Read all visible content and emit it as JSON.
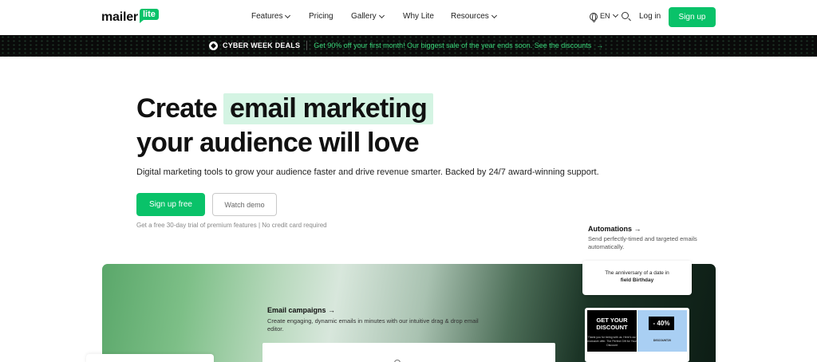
{
  "logo": {
    "text": "mailer",
    "badge": "lite"
  },
  "nav": {
    "items": [
      {
        "label": "Features",
        "dropdown": true
      },
      {
        "label": "Pricing",
        "dropdown": false
      },
      {
        "label": "Gallery",
        "dropdown": true
      },
      {
        "label": "Why Lite",
        "dropdown": false
      },
      {
        "label": "Resources",
        "dropdown": true
      }
    ],
    "language": "EN",
    "login": "Log in",
    "signup": "Sign up"
  },
  "promo": {
    "deal": "CYBER WEEK DEALS",
    "text": "Get 90% off your first month! Our biggest sale of the year ends soon. See the discounts",
    "arrow": "→"
  },
  "hero": {
    "title_prefix": "Create",
    "title_highlight": "email marketing",
    "title_line2": "your audience will love",
    "subtitle": "Digital marketing tools to grow your audience faster and drive revenue smarter. Backed by 24/7 award-winning support.",
    "primary_cta": "Sign up free",
    "secondary_cta": "Watch demo",
    "trial_note": "Get a free 30-day trial of premium features | No credit card required"
  },
  "automations": {
    "title": "Automations →",
    "description": "Send perfectly-timed and targeted emails automatically."
  },
  "email_campaigns": {
    "title": "Email campaigns →",
    "description": "Create engaging, dynamic emails in minutes with our intuitive drag & drop email editor."
  },
  "anniversary_card": {
    "line1": "The anniversary of a date in",
    "line2": "field Birthday"
  },
  "promo_email": {
    "headline_1": "GET YOUR",
    "headline_2": "DISCOUNT",
    "fine_print": "Thank you for being with us. Here's our exclusive offer. The Perfect Gift for Your Discount",
    "badge": "- 40%",
    "code": "DISCOUNT20"
  },
  "colors": {
    "brand_green": "#09c269",
    "highlight": "#d4f4e3",
    "promo_green": "#39d77a"
  }
}
